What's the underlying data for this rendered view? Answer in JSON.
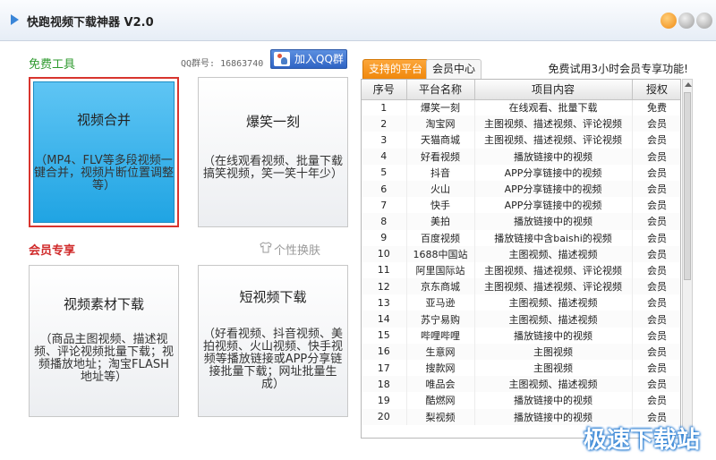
{
  "app": {
    "title": "快跑视频下载神器 V2.0"
  },
  "left": {
    "free_label": "免费工具",
    "qq_group_text": "QQ群号: 16863740",
    "qq_button": "加入QQ群",
    "member_label": "会员专享",
    "skin_label": "个性换肤",
    "tiles": [
      {
        "title": "视频合并",
        "desc": "（MP4、FLV等多段视频一键合并，视频片断位置调整等）"
      },
      {
        "title": "爆笑一刻",
        "desc": "（在线观看视频、批量下载搞笑视频，笑一笑十年少）"
      },
      {
        "title": "视频素材下载",
        "desc": "（商品主图视频、描述视频、评论视频批量下载；视频播放地址；淘宝FLASH地址等）"
      },
      {
        "title": "短视频下载",
        "desc": "（好看视频、抖音视频、美拍视频、火山视频、快手视频等播放链接或APP分享链接批量下载；网址批量生成）"
      }
    ]
  },
  "right": {
    "tabs": [
      "支持的平台",
      "会员中心"
    ],
    "promo": "免费试用3小时会员专享功能!",
    "columns": [
      "序号",
      "平台名称",
      "项目内容",
      "授权"
    ],
    "rows": [
      [
        "1",
        "爆笑一刻",
        "在线观看、批量下载",
        "免费"
      ],
      [
        "2",
        "淘宝网",
        "主图视频、描述视频、评论视频",
        "会员"
      ],
      [
        "3",
        "天猫商城",
        "主图视频、描述视频、评论视频",
        "会员"
      ],
      [
        "4",
        "好看视频",
        "播放链接中的视频",
        "会员"
      ],
      [
        "5",
        "抖音",
        "APP分享链接中的视频",
        "会员"
      ],
      [
        "6",
        "火山",
        "APP分享链接中的视频",
        "会员"
      ],
      [
        "7",
        "快手",
        "APP分享链接中的视频",
        "会员"
      ],
      [
        "8",
        "美拍",
        "播放链接中的视频",
        "会员"
      ],
      [
        "9",
        "百度视频",
        "播放链接中含baishi的视频",
        "会员"
      ],
      [
        "10",
        "1688中国站",
        "主图视频、描述视频",
        "会员"
      ],
      [
        "11",
        "阿里国际站",
        "主图视频、描述视频、评论视频",
        "会员"
      ],
      [
        "12",
        "京东商城",
        "主图视频、描述视频、评论视频",
        "会员"
      ],
      [
        "13",
        "亚马逊",
        "主图视频、描述视频",
        "会员"
      ],
      [
        "14",
        "苏宁易购",
        "主图视频、描述视频",
        "会员"
      ],
      [
        "15",
        "哔哩哔哩",
        "播放链接中的视频",
        "会员"
      ],
      [
        "16",
        "生意网",
        "主图视频",
        "会员"
      ],
      [
        "17",
        "搜款网",
        "主图视频",
        "会员"
      ],
      [
        "18",
        "唯品会",
        "主图视频、描述视频",
        "会员"
      ],
      [
        "19",
        "酷燃网",
        "播放链接中的视频",
        "会员"
      ],
      [
        "20",
        "梨视频",
        "播放链接中的视频",
        "会员"
      ]
    ]
  },
  "watermark": "极速下载站",
  "icons": [
    "play-icon",
    "qq-icon",
    "shirt-icon"
  ]
}
